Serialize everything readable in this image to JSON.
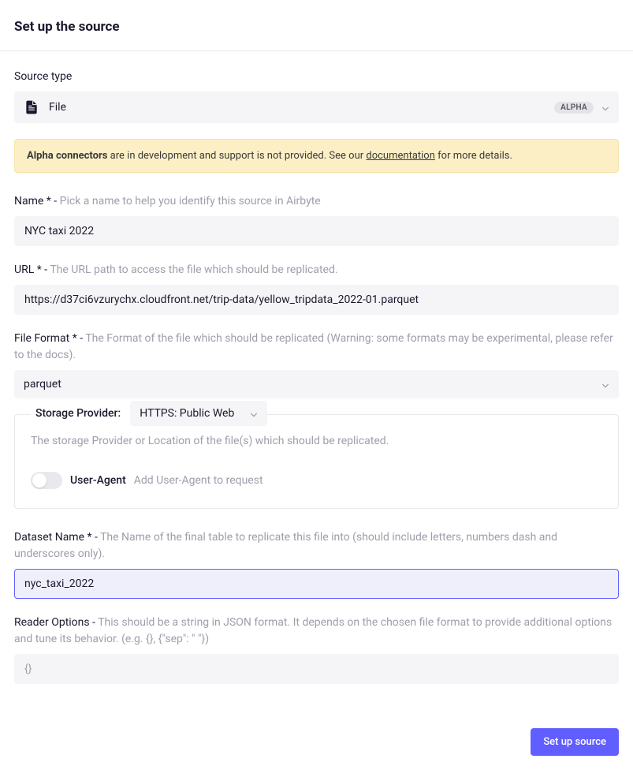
{
  "header": {
    "title": "Set up the source"
  },
  "sourceType": {
    "label": "Source type",
    "value": "File",
    "badge": "ALPHA"
  },
  "alphaBanner": {
    "strong": "Alpha connectors",
    "text1": " are in development and support is not provided. See our ",
    "link": "documentation",
    "text2": " for more details."
  },
  "fields": {
    "name": {
      "label": "Name *",
      "hint": "Pick a name to help you identify this source in Airbyte",
      "value": "NYC taxi 2022"
    },
    "url": {
      "label": "URL *",
      "hint": "The URL path to access the file which should be replicated.",
      "value": "https://d37ci6vzurychx.cloudfront.net/trip-data/yellow_tripdata_2022-01.parquet"
    },
    "fileFormat": {
      "label": "File Format *",
      "hint": "The Format of the file which should be replicated (Warning: some formats may be experimental, please refer to the docs).",
      "value": "parquet"
    },
    "storageProvider": {
      "legend": "Storage Provider:",
      "value": "HTTPS: Public Web",
      "desc": "The storage Provider or Location of the file(s) which should be replicated.",
      "userAgent": {
        "label": "User-Agent",
        "hint": "Add User-Agent to request"
      }
    },
    "datasetName": {
      "label": "Dataset Name *",
      "hint": "The Name of the final table to replicate this file into (should include letters, numbers dash and underscores only).",
      "value": "nyc_taxi_2022"
    },
    "readerOptions": {
      "label": "Reader Options",
      "hint": "This should be a string in JSON format. It depends on the chosen file format to provide additional options and tune its behavior. (e.g. {}, {\"sep\": \" \"})",
      "placeholder": "{}"
    }
  },
  "footer": {
    "submit": "Set up source"
  }
}
